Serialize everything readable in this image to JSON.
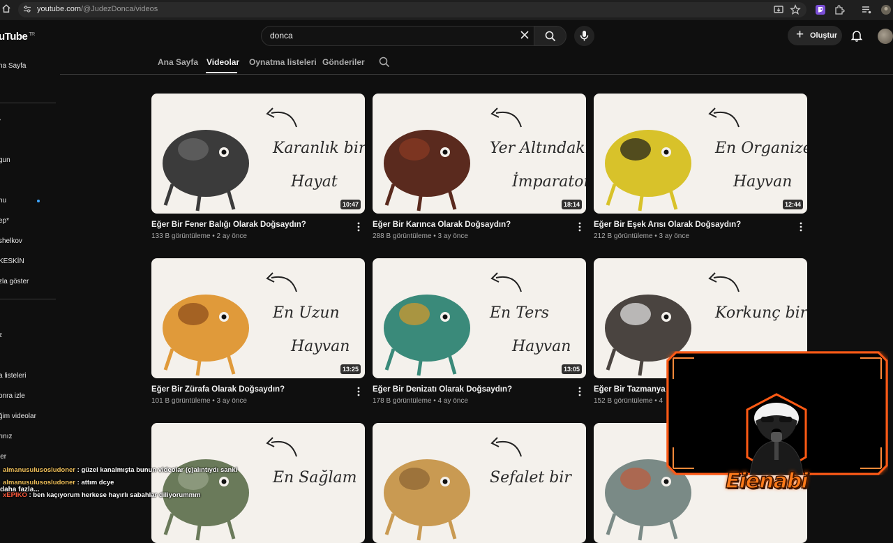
{
  "browser": {
    "url_host": "youtube.com",
    "url_path": "/@JudezDonca/videos"
  },
  "header": {
    "logo_text": "uTube",
    "logo_country": "TR",
    "search_value": "donca",
    "create_label": "Oluştur"
  },
  "sidebar": {
    "items": [
      {
        "label": "na Sayfa"
      },
      {
        "label": "gun"
      },
      {
        "label": "nu"
      },
      {
        "label": "ep*"
      },
      {
        "label": "shelkov"
      },
      {
        "label": "KESKİN"
      },
      {
        "label": "zla göster"
      },
      {
        "label": "z"
      },
      {
        "label": "a listeleri"
      },
      {
        "label": "onra izle"
      },
      {
        "label": "ğim videolar"
      },
      {
        "label": "rınız"
      },
      {
        "label": "ler"
      },
      {
        "label": "daha fazla..."
      }
    ]
  },
  "tabs": [
    {
      "label": "Ana Sayfa"
    },
    {
      "label": "Videolar"
    },
    {
      "label": "Oynatma listeleri"
    },
    {
      "label": "Gönderiler"
    }
  ],
  "videos": [
    {
      "title": "Eğer Bir Fener Balığı Olarak Doğsaydın?",
      "meta": "133 B görüntüleme • 2 ay önce",
      "duration": "10:47",
      "thumb_line1": "Karanlık bir",
      "thumb_line2": "Hayat"
    },
    {
      "title": "Eğer Bir Karınca Olarak Doğsaydın?",
      "meta": "288 B görüntüleme • 3 ay önce",
      "duration": "18:14",
      "thumb_line1": "Yer Altındaki",
      "thumb_line2": "İmparatorluk"
    },
    {
      "title": "Eğer Bir Eşek Arısı Olarak Doğsaydın?",
      "meta": "212 B görüntüleme • 3 ay önce",
      "duration": "12:44",
      "thumb_line1": "En Organize",
      "thumb_line2": "Hayvan"
    },
    {
      "title": "Eğer Bir Zürafa Olarak Doğsaydın?",
      "meta": "101 B görüntüleme • 3 ay önce",
      "duration": "13:25",
      "thumb_line1": "En Uzun",
      "thumb_line2": "Hayvan"
    },
    {
      "title": "Eğer Bir Denizatı Olarak Doğsaydın?",
      "meta": "178 B görüntüleme • 4 ay önce",
      "duration": "13:05",
      "thumb_line1": "En Ters",
      "thumb_line2": "Hayvan"
    },
    {
      "title": "Eğer Bir Tazmanya C",
      "meta": "152 B görüntüleme • 4",
      "duration": "",
      "thumb_line1": "Korkunç bir",
      "thumb_line2": ""
    },
    {
      "title": "",
      "meta": "",
      "duration": "",
      "thumb_line1": "En Sağlam",
      "thumb_line2": ""
    },
    {
      "title": "",
      "meta": "",
      "duration": "",
      "thumb_line1": "Sefalet bir",
      "thumb_line2": ""
    },
    {
      "title": "",
      "meta": "",
      "duration": "",
      "thumb_line1": "",
      "thumb_line2": ""
    }
  ],
  "chat": [
    {
      "user": "almanusulusosludoner",
      "message": ": güzel kanalmışta bunun videolar (ç)alıntıydı sanki"
    },
    {
      "user": "almanusulusosludoner",
      "message": ": attım dcye"
    },
    {
      "user": "xEPIKO",
      "message": ": ben kaçıyorum herkese hayırlı sabahlar diliyorummm"
    }
  ],
  "overlay": {
    "brand_text": "Eienabi",
    "accent_color": "#ff5a14"
  },
  "icons": [
    "home-icon",
    "site-settings-icon",
    "install-icon",
    "star-icon",
    "twitch-icon",
    "extensions-icon",
    "media-icon",
    "profile-icon",
    "close-icon",
    "search-icon",
    "mic-icon",
    "bell-icon",
    "more-vert-icon"
  ]
}
